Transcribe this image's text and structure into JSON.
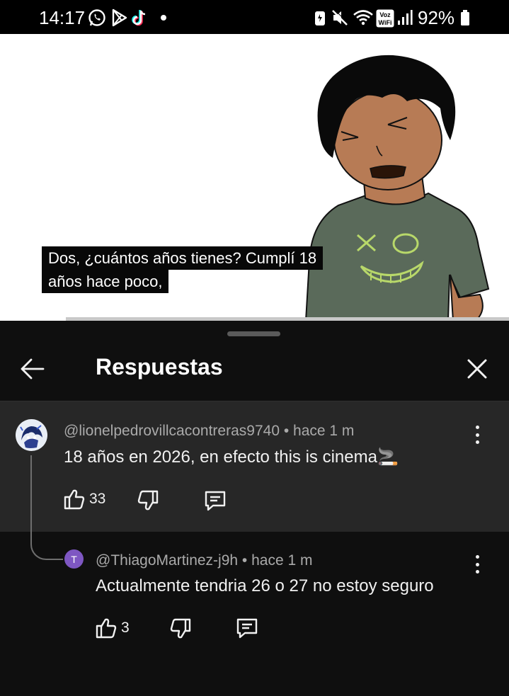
{
  "status_bar": {
    "time": "14:17",
    "left_icons": [
      "whatsapp-icon",
      "play-store-icon",
      "tiktok-icon",
      "dot-icon"
    ],
    "right_icons": [
      "data-saver-icon",
      "mute-icon",
      "wifi-icon",
      "vowifi-icon",
      "signal-icon",
      "battery-icon"
    ],
    "vowifi_label": [
      "Voz",
      "WiFi"
    ],
    "battery": "92%"
  },
  "video": {
    "caption_line1": "Dos, ¿cuántos años tienes? Cumplí 18",
    "caption_line2": "años hace poco,",
    "shirt_mouth_text": "X O"
  },
  "sheet": {
    "title": "Respuestas",
    "back_icon": "arrow-left-icon",
    "close_icon": "close-icon"
  },
  "comments": [
    {
      "author": "@lionelpedrovillcacontreras9740",
      "time": "hace 1 m",
      "text": "18 años en 2026, en efecto this is cinema🚬",
      "likes": "33"
    },
    {
      "avatar_letter": "T",
      "author": "@ThiagoMartinez-j9h",
      "time": "hace 1 m",
      "text": "Actualmente tendria 26 o 27 no estoy seguro",
      "likes": "3"
    }
  ],
  "separator": "•",
  "colors": {
    "sheet_bg": "#0f0f0f",
    "parent_highlight": "#272727",
    "avatar_t": "#7e57c2",
    "secondary_text": "#aaaaaa"
  }
}
